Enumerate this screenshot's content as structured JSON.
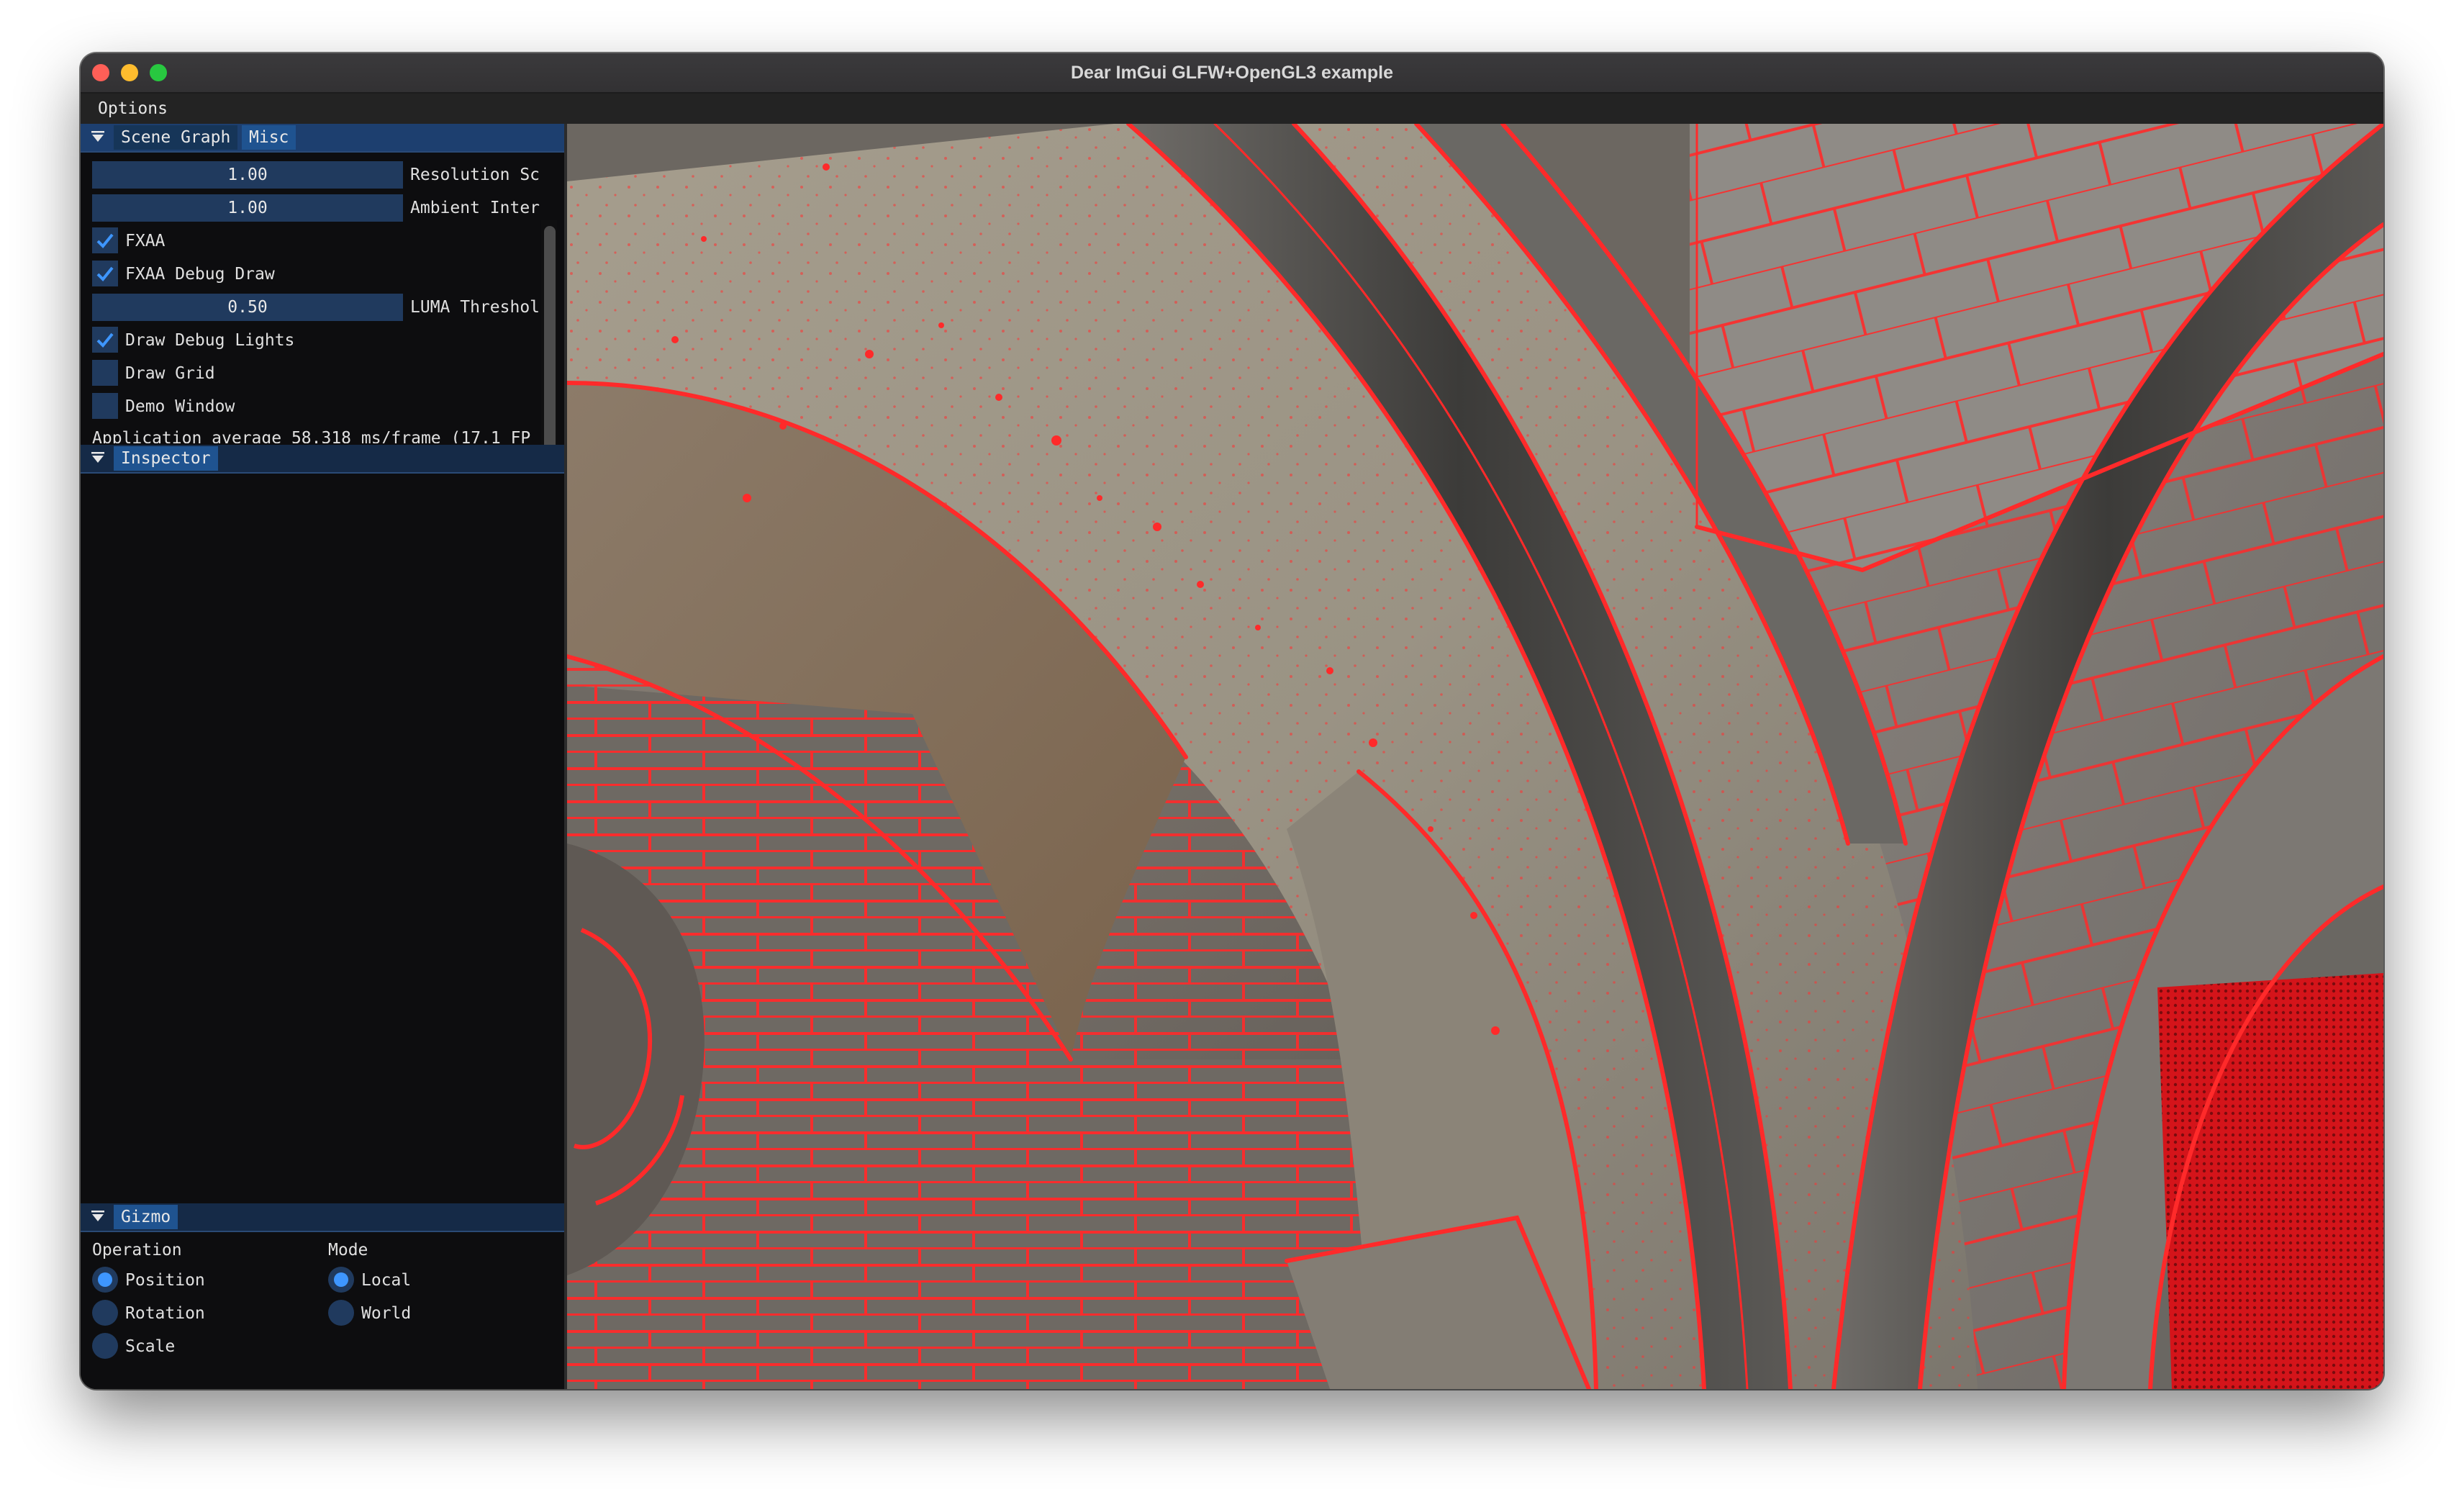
{
  "window": {
    "title": "Dear ImGui GLFW+OpenGL3 example"
  },
  "menubar": {
    "items": [
      "Options"
    ]
  },
  "scene_graph_panel": {
    "tabs": [
      "Scene Graph",
      "Misc"
    ],
    "active_tab": "Misc",
    "sliders": [
      {
        "value": "1.00",
        "label": "Resolution Sc"
      },
      {
        "value": "1.00",
        "label": "Ambient Inter"
      }
    ],
    "checkboxes": [
      {
        "label": "FXAA",
        "checked": true
      },
      {
        "label": "FXAA Debug Draw",
        "checked": true
      }
    ],
    "luma_slider": {
      "value": "0.50",
      "label": "LUMA Threshol"
    },
    "checkboxes2": [
      {
        "label": "Draw Debug Lights",
        "checked": true
      },
      {
        "label": "Draw Grid",
        "checked": false
      },
      {
        "label": "Demo Window",
        "checked": false
      }
    ],
    "status": "Application average 58.318 ms/frame (17.1 FP"
  },
  "inspector_panel": {
    "tab": "Inspector"
  },
  "gizmo_panel": {
    "tab": "Gizmo",
    "operation_label": "Operation",
    "mode_label": "Mode",
    "operations": [
      {
        "label": "Position",
        "selected": true
      },
      {
        "label": "Rotation",
        "selected": false
      },
      {
        "label": "Scale",
        "selected": false
      }
    ],
    "modes": [
      {
        "label": "Local",
        "selected": true
      },
      {
        "label": "World",
        "selected": false
      }
    ]
  },
  "colors": {
    "accent": "#1f5390",
    "frame_bg": "#203a5e",
    "check_mark": "#3e96ff",
    "edge_highlight": "#ff2a2a"
  }
}
